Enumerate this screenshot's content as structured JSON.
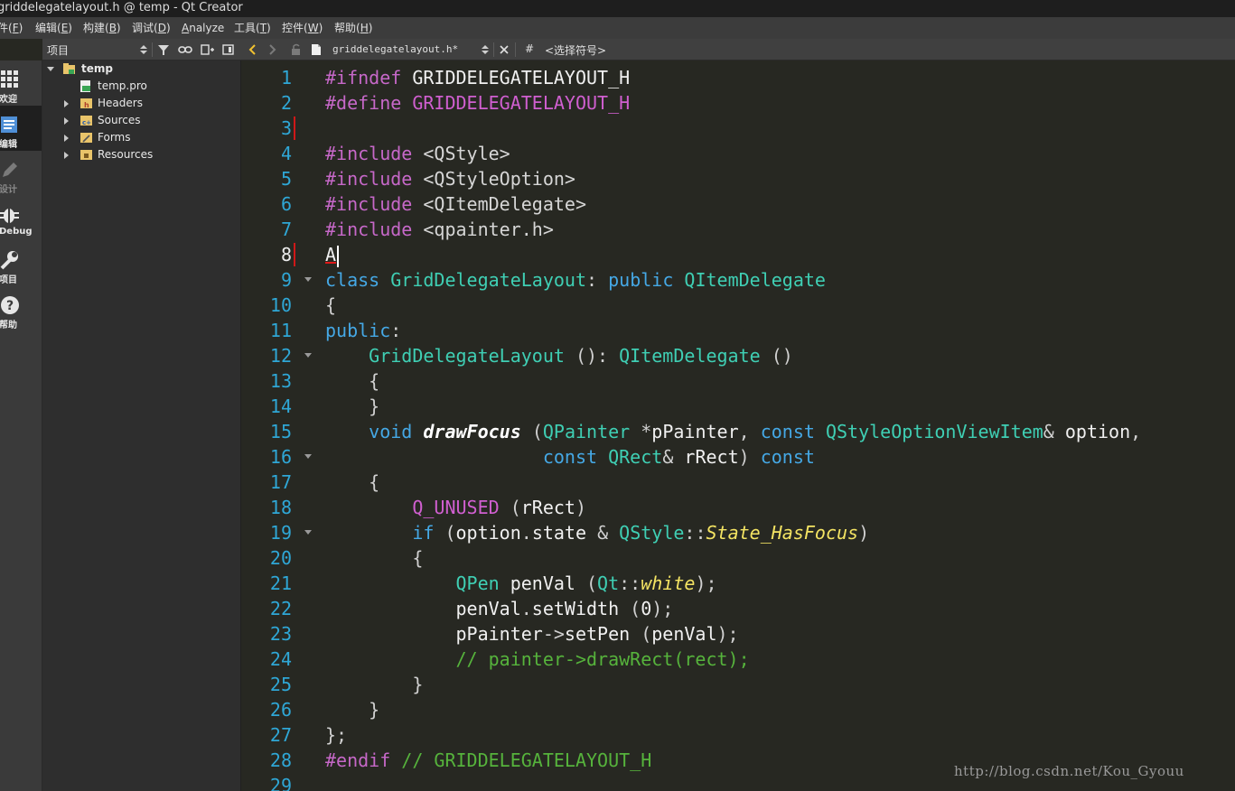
{
  "window": {
    "title": "griddelegatelayout.h @ temp - Qt Creator"
  },
  "menubar": {
    "items": [
      {
        "pre": "件(",
        "u": "F",
        "post": ")"
      },
      {
        "pre": "编辑(",
        "u": "E",
        "post": ")"
      },
      {
        "pre": "构建(",
        "u": "B",
        "post": ")"
      },
      {
        "pre": "调试(",
        "u": "D",
        "post": ")"
      },
      {
        "pre": "",
        "u": "A",
        "post": "nalyze"
      },
      {
        "pre": "工具(",
        "u": "T",
        "post": ")"
      },
      {
        "pre": "控件(",
        "u": "W",
        "post": ")"
      },
      {
        "pre": "帮助(",
        "u": "H",
        "post": ")"
      }
    ]
  },
  "modebar": {
    "modes": [
      {
        "label": "欢迎",
        "icon": "grid-icon"
      },
      {
        "label": "编辑",
        "icon": "edit-document-icon"
      },
      {
        "label": "设计",
        "icon": "pencil-icon"
      },
      {
        "label": "Debug",
        "icon": "bug-icon"
      },
      {
        "label": "项目",
        "icon": "wrench-icon"
      },
      {
        "label": "帮助",
        "icon": "help-icon"
      }
    ]
  },
  "project_panel": {
    "selector": "项目",
    "tree": {
      "root": "temp",
      "items": [
        {
          "label": "temp.pro",
          "icon": "qt-pro-file-icon"
        },
        {
          "label": "Headers",
          "icon": "headers-folder-icon"
        },
        {
          "label": "Sources",
          "icon": "sources-folder-icon"
        },
        {
          "label": "Forms",
          "icon": "forms-folder-icon"
        },
        {
          "label": "Resources",
          "icon": "resources-folder-icon"
        }
      ]
    }
  },
  "editor_toolbar": {
    "file_name": "griddelegatelayout.h*",
    "hash": "#",
    "symbol_selector": "<选择符号>"
  },
  "editor": {
    "line_numbers": [
      "1",
      "2",
      "3",
      "4",
      "5",
      "6",
      "7",
      "8",
      "9",
      "10",
      "11",
      "12",
      "13",
      "14",
      "15",
      "16",
      "17",
      "18",
      "19",
      "20",
      "21",
      "22",
      "23",
      "24",
      "25",
      "26",
      "27",
      "28",
      "29"
    ],
    "current_line": "8",
    "lines": [
      {
        "tokens": [
          [
            "t-pre",
            "#ifndef"
          ],
          [
            "t-plain",
            " GRIDDELEGATELAYOUT_H"
          ]
        ]
      },
      {
        "tokens": [
          [
            "t-pre",
            "#define"
          ],
          [
            "t-plain",
            " "
          ],
          [
            "t-macro",
            "GRIDDELEGATELAYOUT_H"
          ]
        ]
      },
      {
        "tokens": []
      },
      {
        "tokens": [
          [
            "t-pre",
            "#include"
          ],
          [
            "t-plain",
            " "
          ],
          [
            "t-str",
            "<QStyle>"
          ]
        ]
      },
      {
        "tokens": [
          [
            "t-pre",
            "#include"
          ],
          [
            "t-plain",
            " "
          ],
          [
            "t-str",
            "<QStyleOption>"
          ]
        ]
      },
      {
        "tokens": [
          [
            "t-pre",
            "#include"
          ],
          [
            "t-plain",
            " "
          ],
          [
            "t-str",
            "<QItemDelegate>"
          ]
        ]
      },
      {
        "tokens": [
          [
            "t-pre",
            "#include"
          ],
          [
            "t-plain",
            " "
          ],
          [
            "t-str",
            "<qpainter.h>"
          ]
        ]
      },
      {
        "tokens": [
          [
            "t-err",
            "A"
          ]
        ]
      },
      {
        "tokens": [
          [
            "t-key",
            "class"
          ],
          [
            "t-plain",
            " "
          ],
          [
            "t-type",
            "GridDelegateLayout"
          ],
          [
            "t-punct",
            ": "
          ],
          [
            "t-key",
            "public"
          ],
          [
            "t-plain",
            " "
          ],
          [
            "t-type",
            "QItemDelegate"
          ]
        ]
      },
      {
        "tokens": [
          [
            "t-punct",
            "{"
          ]
        ]
      },
      {
        "tokens": [
          [
            "t-key",
            "public"
          ],
          [
            "t-punct",
            ":"
          ]
        ]
      },
      {
        "tokens": [
          [
            "t-plain",
            "    "
          ],
          [
            "t-type",
            "GridDelegateLayout"
          ],
          [
            "t-plain",
            " "
          ],
          [
            "t-punct",
            "(): "
          ],
          [
            "t-type",
            "QItemDelegate"
          ],
          [
            "t-plain",
            " "
          ],
          [
            "t-punct",
            "()"
          ]
        ]
      },
      {
        "tokens": [
          [
            "t-plain",
            "    "
          ],
          [
            "t-punct",
            "{"
          ]
        ]
      },
      {
        "tokens": [
          [
            "t-plain",
            "    "
          ],
          [
            "t-punct",
            "}"
          ]
        ]
      },
      {
        "tokens": [
          [
            "t-plain",
            "    "
          ],
          [
            "t-key",
            "void"
          ],
          [
            "t-plain",
            " "
          ],
          [
            "t-fn",
            "drawFocus"
          ],
          [
            "t-plain",
            " "
          ],
          [
            "t-punct",
            "("
          ],
          [
            "t-type",
            "QPainter"
          ],
          [
            "t-plain",
            " "
          ],
          [
            "t-punct",
            "*"
          ],
          [
            "t-plain",
            "pPainter"
          ],
          [
            "t-punct",
            ", "
          ],
          [
            "t-key",
            "const"
          ],
          [
            "t-plain",
            " "
          ],
          [
            "t-type",
            "QStyleOptionViewItem"
          ],
          [
            "t-punct",
            "& "
          ],
          [
            "t-plain",
            "option"
          ],
          [
            "t-punct",
            ","
          ]
        ]
      },
      {
        "tokens": [
          [
            "t-plain",
            "                    "
          ],
          [
            "t-key",
            "const"
          ],
          [
            "t-plain",
            " "
          ],
          [
            "t-type",
            "QRect"
          ],
          [
            "t-punct",
            "& "
          ],
          [
            "t-plain",
            "rRect"
          ],
          [
            "t-punct",
            ") "
          ],
          [
            "t-key",
            "const"
          ]
        ]
      },
      {
        "tokens": [
          [
            "t-plain",
            "    "
          ],
          [
            "t-punct",
            "{"
          ]
        ]
      },
      {
        "tokens": [
          [
            "t-plain",
            "        "
          ],
          [
            "t-macro",
            "Q_UNUSED"
          ],
          [
            "t-plain",
            " "
          ],
          [
            "t-punct",
            "("
          ],
          [
            "t-plain",
            "rRect"
          ],
          [
            "t-punct",
            ")"
          ]
        ]
      },
      {
        "tokens": [
          [
            "t-plain",
            "        "
          ],
          [
            "t-key",
            "if"
          ],
          [
            "t-plain",
            " "
          ],
          [
            "t-punct",
            "("
          ],
          [
            "t-plain",
            "option"
          ],
          [
            "t-punct",
            "."
          ],
          [
            "t-plain",
            "state "
          ],
          [
            "t-punct",
            "& "
          ],
          [
            "t-type",
            "QStyle"
          ],
          [
            "t-punct",
            "::"
          ],
          [
            "t-enum",
            "State_HasFocus"
          ],
          [
            "t-punct",
            ")"
          ]
        ]
      },
      {
        "tokens": [
          [
            "t-plain",
            "        "
          ],
          [
            "t-punct",
            "{"
          ]
        ]
      },
      {
        "tokens": [
          [
            "t-plain",
            "            "
          ],
          [
            "t-type",
            "QPen"
          ],
          [
            "t-plain",
            " penVal "
          ],
          [
            "t-punct",
            "("
          ],
          [
            "t-type",
            "Qt"
          ],
          [
            "t-punct",
            "::"
          ],
          [
            "t-enum",
            "white"
          ],
          [
            "t-punct",
            ");"
          ]
        ]
      },
      {
        "tokens": [
          [
            "t-plain",
            "            penVal"
          ],
          [
            "t-punct",
            "."
          ],
          [
            "t-plain",
            "setWidth "
          ],
          [
            "t-punct",
            "("
          ],
          [
            "t-plain",
            "0"
          ],
          [
            "t-punct",
            ");"
          ]
        ]
      },
      {
        "tokens": [
          [
            "t-plain",
            "            pPainter"
          ],
          [
            "t-punct",
            "->"
          ],
          [
            "t-plain",
            "setPen "
          ],
          [
            "t-punct",
            "("
          ],
          [
            "t-plain",
            "penVal"
          ],
          [
            "t-punct",
            ");"
          ]
        ]
      },
      {
        "tokens": [
          [
            "t-plain",
            "            "
          ],
          [
            "t-comment",
            "// painter->drawRect(rect);"
          ]
        ]
      },
      {
        "tokens": [
          [
            "t-plain",
            "        "
          ],
          [
            "t-punct",
            "}"
          ]
        ]
      },
      {
        "tokens": [
          [
            "t-plain",
            "    "
          ],
          [
            "t-punct",
            "}"
          ]
        ]
      },
      {
        "tokens": [
          [
            "t-punct",
            "};"
          ]
        ]
      },
      {
        "tokens": [
          [
            "t-pre",
            "#endif"
          ],
          [
            "t-plain",
            " "
          ],
          [
            "t-comment",
            "// GRIDDELEGATELAYOUT_H"
          ]
        ]
      },
      {
        "tokens": []
      }
    ],
    "fold_lines": [
      "9",
      "12",
      "16",
      "19"
    ],
    "modified_lines": [
      "3",
      "8"
    ]
  },
  "watermark": "http://blog.csdn.net/Kou_Gyouu",
  "colors": {
    "editor_bg": "#272822",
    "line_number": "#2fa7d6",
    "keyword": "#45a8e5",
    "type": "#3fcfb4",
    "preprocessor": "#c668c8",
    "comment": "#56b33c",
    "enum_italic": "#f4e463",
    "modified_marker": "#d01818"
  }
}
